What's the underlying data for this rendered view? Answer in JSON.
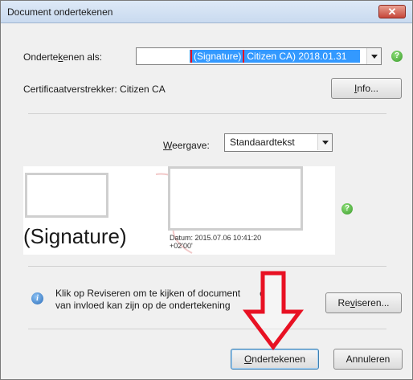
{
  "window": {
    "title": "Document ondertekenen",
    "close_symbol": "✕"
  },
  "signer": {
    "label": "Ondertekenen als:",
    "label_pre": "Onderte",
    "label_key": "k",
    "label_post": "enen als:",
    "selected_highlight": "(Signature)",
    "selected_rest": "Citizen CA) 2018.01.31"
  },
  "issuer": {
    "text": "Certificaatverstrekker: Citizen CA"
  },
  "info_button": {
    "pre": "",
    "key": "I",
    "post": "nfo..."
  },
  "appearance": {
    "label_key": "W",
    "label_rest": "eergave:",
    "selected": "Standaardtekst"
  },
  "preview": {
    "signature_text": "(Signature)",
    "datum_line1": "Datum: 2015.07.06 10:41:20",
    "datum_line2": "+02'00'"
  },
  "review": {
    "line1": "Klik op Reviseren om te kijken of documentinhoud",
    "line1_visible": "Klik op Reviseren om te kijken of document",
    "line1_tail": "d",
    "line2": "van invloed kan zijn op de ondertekening"
  },
  "reviseren_button": {
    "pre": "Re",
    "key": "v",
    "post": "iseren..."
  },
  "sign_button": {
    "key": "O",
    "post": "ndertekenen"
  },
  "cancel_button": {
    "label": "Annuleren"
  },
  "help_symbol": "?",
  "info_symbol": "i",
  "colors": {
    "highlight_outline": "#e81123",
    "arrow": "#e81123",
    "selection": "#3399ff"
  }
}
